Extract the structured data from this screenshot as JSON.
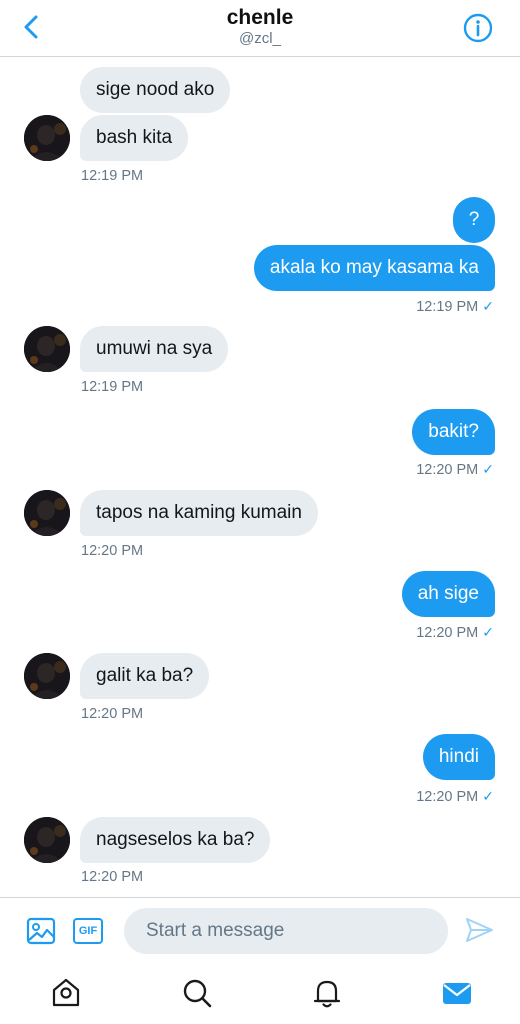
{
  "header": {
    "title": "chenle",
    "handle": "@zcl_",
    "back_icon": "chevron-left-icon",
    "info_icon": "info-icon"
  },
  "messages": [
    {
      "from": "them",
      "text": "sige nood ako"
    },
    {
      "from": "them",
      "text": "bash kita"
    },
    {
      "from": "them",
      "time": "12:19 PM"
    },
    {
      "from": "me",
      "text": "?"
    },
    {
      "from": "me",
      "text": "akala ko may kasama ka"
    },
    {
      "from": "me",
      "time": "12:19 PM",
      "read": true
    },
    {
      "from": "them",
      "text": "umuwi na sya"
    },
    {
      "from": "them",
      "time": "12:19 PM"
    },
    {
      "from": "me",
      "text": "bakit?"
    },
    {
      "from": "me",
      "time": "12:20 PM",
      "read": true
    },
    {
      "from": "them",
      "text": "tapos na kaming kumain"
    },
    {
      "from": "them",
      "time": "12:20 PM"
    },
    {
      "from": "me",
      "text": "ah sige"
    },
    {
      "from": "me",
      "time": "12:20 PM",
      "read": true
    },
    {
      "from": "them",
      "text": "galit ka ba?"
    },
    {
      "from": "them",
      "time": "12:20 PM"
    },
    {
      "from": "me",
      "text": "hindi"
    },
    {
      "from": "me",
      "time": "12:20 PM",
      "read": true
    },
    {
      "from": "them",
      "text": "nagseselos ka ba?"
    },
    {
      "from": "them",
      "time": "12:20 PM"
    }
  ],
  "composer": {
    "placeholder": "Start a message",
    "gif_label": "GIF",
    "media_icon": "image-icon",
    "send_icon": "send-icon"
  },
  "tabbar": {
    "items": [
      "home-icon",
      "search-icon",
      "bell-icon",
      "mail-icon"
    ],
    "active": "mail-icon"
  },
  "colors": {
    "accent": "#1d9bf0",
    "incoming_bubble": "#e6ecf0",
    "muted_text": "#657786"
  },
  "check_mark": "✓"
}
